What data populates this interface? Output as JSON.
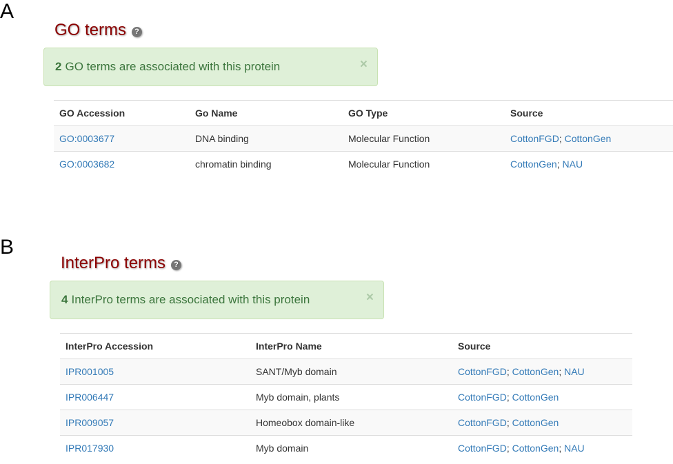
{
  "panel_a": {
    "letter": "A",
    "title": "GO terms",
    "help_icon": "question-circle-icon",
    "alert": {
      "count": "2",
      "text": "GO terms are associated with this protein",
      "close": "×"
    },
    "columns": [
      "GO Accession",
      "Go Name",
      "GO Type",
      "Source"
    ],
    "rows": [
      {
        "accession": "GO:0003677",
        "name": "DNA binding",
        "type": "Molecular Function",
        "sources": [
          "CottonFGD",
          "CottonGen"
        ]
      },
      {
        "accession": "GO:0003682",
        "name": "chromatin binding",
        "type": "Molecular Function",
        "sources": [
          "CottonGen",
          "NAU"
        ]
      }
    ]
  },
  "panel_b": {
    "letter": "B",
    "title": "InterPro terms",
    "help_icon": "question-circle-icon",
    "alert": {
      "count": "4",
      "text": "InterPro terms are associated with this protein",
      "close": "×"
    },
    "columns": [
      "InterPro Accession",
      "InterPro Name",
      "Source"
    ],
    "rows": [
      {
        "accession": "IPR001005",
        "name": "SANT/Myb domain",
        "sources": [
          "CottonFGD",
          "CottonGen",
          "NAU"
        ]
      },
      {
        "accession": "IPR006447",
        "name": "Myb domain, plants",
        "sources": [
          "CottonFGD",
          "CottonGen"
        ]
      },
      {
        "accession": "IPR009057",
        "name": "Homeobox domain-like",
        "sources": [
          "CottonFGD",
          "CottonGen"
        ]
      },
      {
        "accession": "IPR017930",
        "name": "Myb domain",
        "sources": [
          "CottonFGD",
          "CottonGen",
          "NAU"
        ]
      }
    ]
  },
  "colors": {
    "heading": "#8b0000",
    "link": "#337ab7",
    "alert_bg": "#dff0d8",
    "alert_text": "#3c763d"
  }
}
